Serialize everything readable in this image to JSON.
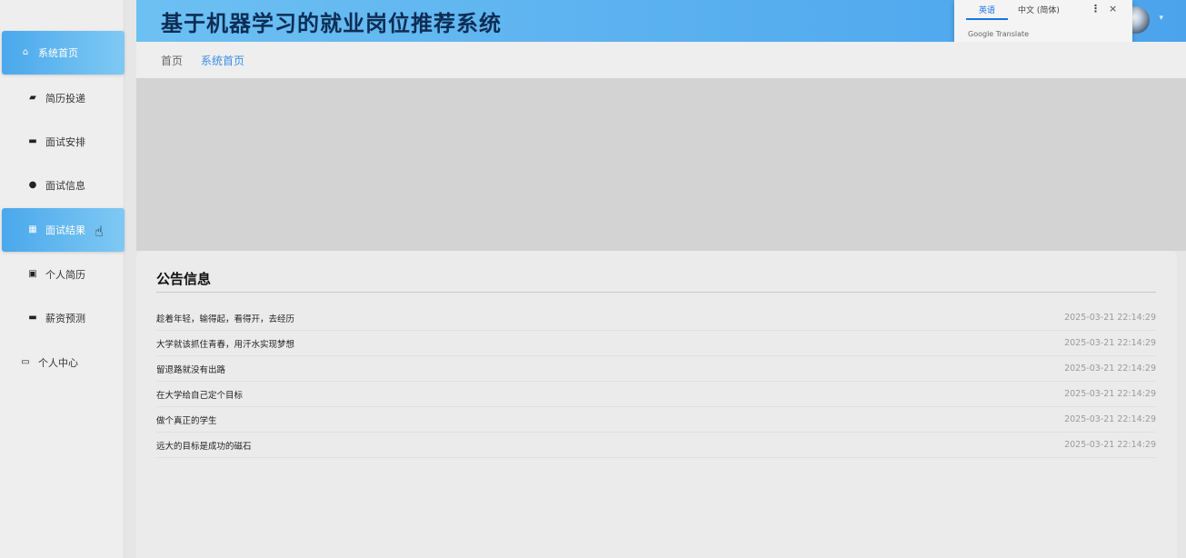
{
  "header": {
    "title": "基于机器学习的就业岗位推荐系统"
  },
  "translate_popup": {
    "tab_source": "英语",
    "tab_target": "中文 (简体)",
    "menu_icon": "⋮",
    "close_icon": "×",
    "brand": "Google Translate"
  },
  "sidebar": {
    "items": [
      {
        "label": "系统首页",
        "icon": "home-icon",
        "active": true
      },
      {
        "label": "简历投递",
        "icon": "send-icon",
        "active": false
      },
      {
        "label": "面试安排",
        "icon": "monitor-icon",
        "active": false
      },
      {
        "label": "面试信息",
        "icon": "location-icon",
        "active": false
      },
      {
        "label": "面试结果",
        "icon": "grid-icon",
        "active": true
      },
      {
        "label": "个人简历",
        "icon": "clipboard-icon",
        "active": false
      },
      {
        "label": "薪资预测",
        "icon": "screen-icon",
        "active": false
      },
      {
        "label": "个人中心",
        "icon": "profile-card-icon",
        "active": false
      }
    ]
  },
  "breadcrumb": {
    "home": "首页",
    "current": "系统首页"
  },
  "notices": {
    "title": "公告信息",
    "items": [
      {
        "text": "趁着年轻，输得起，看得开，去经历",
        "time": "2025-03-21 22:14:29"
      },
      {
        "text": "大学就该抓住青春，用汗水实现梦想",
        "time": "2025-03-21 22:14:29"
      },
      {
        "text": "留退路就没有出路",
        "time": "2025-03-21 22:14:29"
      },
      {
        "text": "在大学给自己定个目标",
        "time": "2025-03-21 22:14:29"
      },
      {
        "text": "做个真正的学生",
        "time": "2025-03-21 22:14:29"
      },
      {
        "text": "远大的目标是成功的磁石",
        "time": "2025-03-21 22:14:29"
      }
    ]
  },
  "colors": {
    "header_gradient_start": "#6cc0f2",
    "header_gradient_end": "#4ba3ec",
    "active_menu": "#4aa8ec",
    "breadcrumb_current": "#3a8ee6"
  }
}
